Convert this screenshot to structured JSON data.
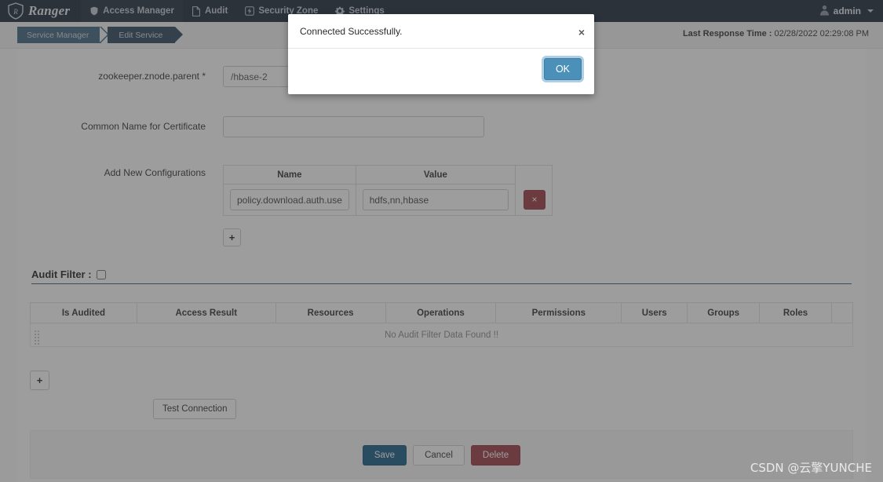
{
  "nav": {
    "brand": "Ranger",
    "brand_icon": "ranger-shield-logo",
    "items": [
      {
        "label": "Access Manager",
        "icon": "shield-icon",
        "active": true
      },
      {
        "label": "Audit",
        "icon": "file-icon",
        "active": false
      },
      {
        "label": "Security Zone",
        "icon": "zone-bolt-icon",
        "active": false
      },
      {
        "label": "Settings",
        "icon": "gear-icon",
        "active": false
      }
    ],
    "user": "admin",
    "user_icon": "user-icon",
    "caret_icon": "chevron-down-icon"
  },
  "breadcrumb": {
    "items": [
      "Service Manager",
      "Edit Service"
    ]
  },
  "status": {
    "last_response_label": "Last Response Time :",
    "last_response_value": "02/28/2022 02:29:08 PM"
  },
  "form": {
    "znode": {
      "label": "zookeeper.znode.parent *",
      "value": "/hbase-2"
    },
    "common_name": {
      "label": "Common Name for Certificate",
      "value": "",
      "placeholder": ""
    },
    "add_new_configurations": {
      "label": "Add New Configurations",
      "columns": [
        "Name",
        "Value"
      ],
      "rows": [
        {
          "name": "policy.download.auth.users",
          "value": "hdfs,nn,hbase",
          "remove_label": "×"
        }
      ],
      "add_label": "+"
    }
  },
  "audit_filter": {
    "label": "Audit Filter :",
    "checked": false,
    "columns": [
      "Is Audited",
      "Access Result",
      "Resources",
      "Operations",
      "Permissions",
      "Users",
      "Groups",
      "Roles"
    ],
    "empty_message": "No Audit Filter Data Found !!",
    "add_label": "+"
  },
  "actions": {
    "test_connection": "Test Connection",
    "save": "Save",
    "cancel": "Cancel",
    "delete": "Delete"
  },
  "modal": {
    "message": "Connected Successfully.",
    "close_label": "×",
    "ok_label": "OK"
  },
  "watermark": "CSDN @云擎YUNCHE",
  "colors": {
    "navbar": "#1b2838",
    "crumb_primary": "#3e6480",
    "crumb_secondary": "#2c465c",
    "accent_blue": "#175d87",
    "danger_red": "#9b3a44",
    "ok_button": "#4a90b8",
    "rule": "#3b5f7d"
  }
}
